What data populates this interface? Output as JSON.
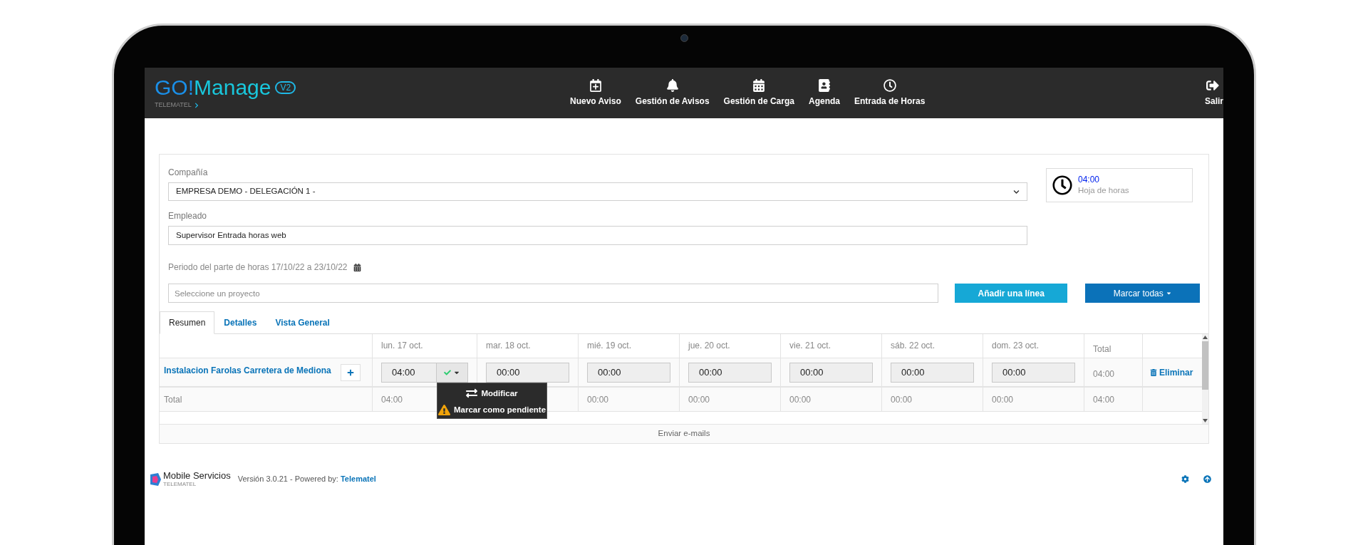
{
  "header": {
    "logo": {
      "strong": "GO!",
      "rest": "Manage",
      "version": "V2",
      "company": "TELEMATEL"
    },
    "nav": [
      {
        "label": "Nuevo Aviso"
      },
      {
        "label": "Gestión de Avisos"
      },
      {
        "label": "Gestión de Carga"
      },
      {
        "label": "Agenda"
      },
      {
        "label": "Entrada de Horas"
      }
    ],
    "logout": {
      "label": "Salir"
    }
  },
  "form": {
    "company": {
      "label": "Compañía",
      "value": "EMPRESA DEMO - DELEGACIÓN 1 -"
    },
    "employee": {
      "label": "Empleado",
      "value": "Supervisor Entrada horas web"
    },
    "period": {
      "label": "Periodo del parte de horas",
      "value": "17/10/22 a 23/10/22"
    },
    "project": {
      "placeholder": "Seleccione un proyecto"
    },
    "add_button": "Añadir una línea",
    "mark_all_button": "Marcar todas"
  },
  "summary": {
    "value": "04:00",
    "label": "Hoja de horas"
  },
  "tabs": [
    {
      "label": "Resumen",
      "selected": true
    },
    {
      "label": "Detalles",
      "selected": false
    },
    {
      "label": "Vista General",
      "selected": false
    }
  ],
  "table": {
    "columns": [
      "lun. 17 oct.",
      "mar. 18 oct.",
      "mié. 19 oct.",
      "jue. 20 oct.",
      "vie. 21 oct.",
      "sáb. 22 oct.",
      "dom. 23 oct.",
      "Total"
    ],
    "rows": [
      {
        "project": "Instalacion Farolas Carretera de Mediona",
        "cells": [
          {
            "value": "04:00",
            "kind": "confirmed",
            "menu": [
              {
                "label": "Modificar",
                "kind": "swap"
              },
              {
                "label": "Marcar como pendiente",
                "kind": "warning"
              }
            ]
          },
          {
            "value": "00:00",
            "kind": "plain"
          },
          {
            "value": "00:00",
            "kind": "plain"
          },
          {
            "value": "00:00",
            "kind": "plain"
          },
          {
            "value": "00:00",
            "kind": "plain"
          },
          {
            "value": "00:00",
            "kind": "plain"
          },
          {
            "value": "00:00",
            "kind": "plain"
          }
        ],
        "total": "04:00",
        "action": "Eliminar"
      }
    ],
    "totals": {
      "label": "Total",
      "cells": [
        "04:00",
        null,
        "00:00",
        "00:00",
        "00:00",
        "00:00",
        "00:00"
      ],
      "total": "04:00"
    },
    "send_button": "Enviar e-mails"
  },
  "footer": {
    "brand": "Mobile Servicios",
    "brand_sub": "TELEMATEL",
    "version_text": "Versión 3.0.21 - Powered by:",
    "link": "Telematel"
  }
}
